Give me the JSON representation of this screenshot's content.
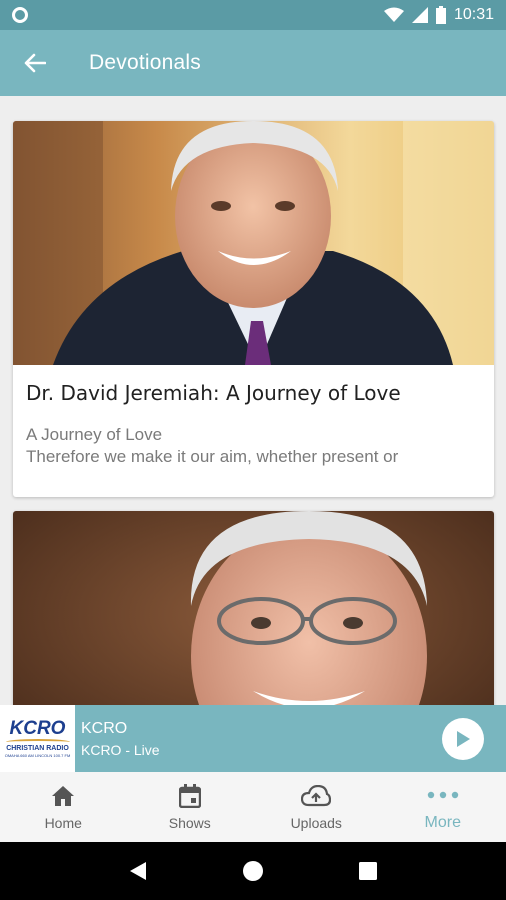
{
  "status_bar": {
    "time": "10:31"
  },
  "app_bar": {
    "title": "Devotionals"
  },
  "cards": [
    {
      "title": "Dr. David Jeremiah: A Journey of Love",
      "subtitle_line1": "A Journey of Love",
      "subtitle_line2": "Therefore we make it our aim, whether present or"
    },
    {
      "title": ""
    }
  ],
  "player": {
    "logo_text": "KCRO",
    "logo_sub": "CHRISTIAN RADIO",
    "logo_tiny": "OMAHA 660 AM   LINCOLN 100.7 FM",
    "station": "KCRO",
    "status": "KCRO - Live"
  },
  "bottom_nav": {
    "items": [
      {
        "label": "Home",
        "icon": "home-icon"
      },
      {
        "label": "Shows",
        "icon": "calendar-icon"
      },
      {
        "label": "Uploads",
        "icon": "cloud-upload-icon"
      },
      {
        "label": "More",
        "icon": "more-dots-icon"
      }
    ],
    "active_index": 3,
    "accent_color": "#79b6bf"
  },
  "colors": {
    "app_bar": "#79b6bf",
    "status_bar": "#5b9ba5"
  }
}
